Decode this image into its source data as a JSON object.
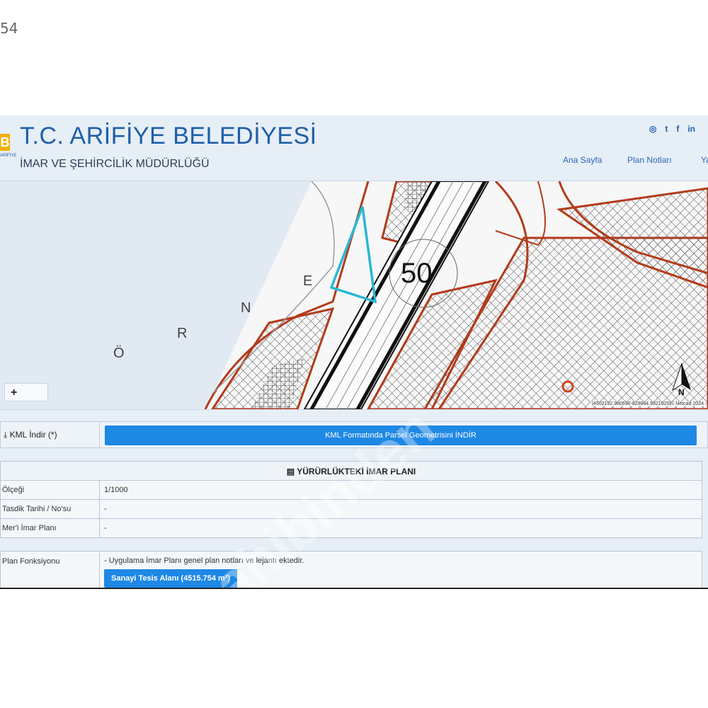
{
  "corner_text": "54",
  "header": {
    "logo_letter": "B",
    "logo_sub": "ARİFİYE",
    "title": "T.C. ARİFİYE BELEDİYESİ",
    "subtitle": "İMAR VE ŞEHİRCİLİK MÜDÜRLÜĞÜ",
    "social_icons": [
      "instagram-icon",
      "twitter-icon",
      "facebook-icon",
      "linkedin-icon"
    ],
    "social_glyphs": [
      "◎",
      "t",
      "f",
      "in"
    ]
  },
  "nav": {
    "items": [
      {
        "label": "Ana Sayfa"
      },
      {
        "label": "Plan Notları"
      },
      {
        "label": "Ya"
      }
    ]
  },
  "map": {
    "scale_label": "50",
    "area_letters": [
      "Ö",
      "R",
      "N",
      "E"
    ],
    "zoom_label": "+",
    "north_label": "N",
    "attribution": "|4503192.980696-829884.9921820|© Netcad 2024",
    "parcel_color": "#2ab8d4",
    "road_color": "#b33a1a"
  },
  "kml": {
    "label": "KML İndir (*)",
    "button": "KML Formatında Parsel Geometrisini İNDİR"
  },
  "plan_table": {
    "heading": "YÜRÜRLÜKTEKİ İMAR PLANI",
    "rows": [
      {
        "label": "Ölçeği",
        "value": "1/1000"
      },
      {
        "label": "Tasdik Tarihi / No'su",
        "value": "-"
      },
      {
        "label": "Mer'i İmar Planı",
        "value": "-"
      }
    ],
    "function_label": "Plan Fonksiyonu",
    "function_note": "- Uygulama İmar Planı genel plan notları ve lejantı ektedir.",
    "function_tag": "Sanayi Tesis Alanı (4515.754 m²)"
  },
  "watermark": "sahibinden",
  "colors": {
    "brand_blue": "#1f5fa8",
    "button_blue": "#1e88e5",
    "logo_yellow": "#f2b200"
  }
}
